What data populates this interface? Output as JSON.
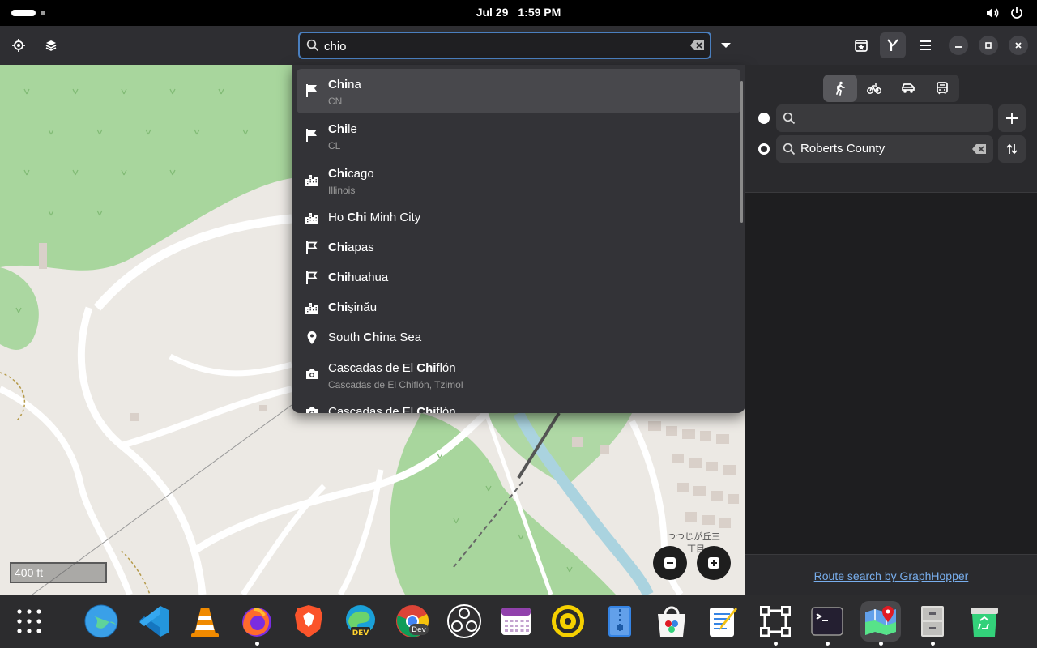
{
  "topbar": {
    "date": "Jul 29",
    "time": "1:59 PM",
    "icons": [
      "activities-icon",
      "volume-icon",
      "power-icon"
    ]
  },
  "header": {
    "search_value": "chio",
    "icons": [
      "locate-icon",
      "layers-icon",
      "search-icon",
      "clear-icon",
      "dropdown-icon",
      "favorites-icon",
      "route-icon",
      "menu-icon",
      "minimize-icon",
      "maximize-icon",
      "close-icon"
    ]
  },
  "suggestions": [
    {
      "bold": "Chi",
      "rest": "na",
      "pre": "",
      "sub": "CN",
      "icon": "flag-filled-icon",
      "selected": true
    },
    {
      "bold": "Chi",
      "rest": "le",
      "pre": "",
      "sub": "CL",
      "icon": "flag-filled-icon"
    },
    {
      "bold": "Chi",
      "rest": "cago",
      "pre": "",
      "sub": "Illinois",
      "icon": "city-icon"
    },
    {
      "pre": "Ho ",
      "bold": "Chi",
      "rest": " Minh City",
      "sub": "",
      "icon": "city-icon"
    },
    {
      "bold": "Chi",
      "rest": "apas",
      "pre": "",
      "sub": "",
      "icon": "flag-outline-icon"
    },
    {
      "bold": "Chi",
      "rest": "huahua",
      "pre": "",
      "sub": "",
      "icon": "flag-outline-icon"
    },
    {
      "bold": "Chi",
      "rest": "șinău",
      "pre": "",
      "sub": "",
      "icon": "city-icon"
    },
    {
      "pre": "South ",
      "bold": "Chi",
      "rest": "na Sea",
      "sub": "",
      "icon": "pin-icon"
    },
    {
      "pre": "Cascadas de El ",
      "bold": "Chi",
      "rest": "flón",
      "sub": "Cascadas de El Chiflón, Tzimol",
      "icon": "camera-icon"
    },
    {
      "pre": "Cascadas de El ",
      "bold": "Chi",
      "rest": "flón",
      "sub": "",
      "icon": "camera-icon"
    }
  ],
  "map": {
    "scale_label": "400 ft",
    "label_1": "つつじが丘三",
    "label_2": "丁目",
    "zoom_out": "zoom-out-icon",
    "zoom_in": "zoom-in-icon"
  },
  "route": {
    "modes": [
      "walk-icon",
      "bike-icon",
      "car-icon",
      "transit-icon"
    ],
    "active_mode": "walk-icon",
    "from_value": "",
    "to_value": "Roberts County",
    "footer_link": "Route search by GraphHopper"
  },
  "dock": {
    "apps": [
      "app-grid-icon",
      "web-browser-icon",
      "vscode-icon",
      "vlc-icon",
      "firefox-icon",
      "brave-icon",
      "edge-dev-icon",
      "chrome-dev-icon",
      "obs-icon",
      "calendar-icon",
      "rhythmbox-icon",
      "archive-icon",
      "software-icon",
      "text-editor-icon",
      "inkscape-icon",
      "terminal-icon",
      "maps-icon",
      "files-cabinet-icon",
      "trash-icon"
    ],
    "running": [
      "firefox-icon",
      "terminal-icon",
      "maps-icon",
      "files-cabinet-icon",
      "inkscape-icon"
    ]
  },
  "colors": {
    "accent": "#4a7fbf",
    "link": "#78aeed",
    "map_land": "#ece9e4",
    "map_park": "#a8d69d",
    "map_water": "#aad3df"
  }
}
